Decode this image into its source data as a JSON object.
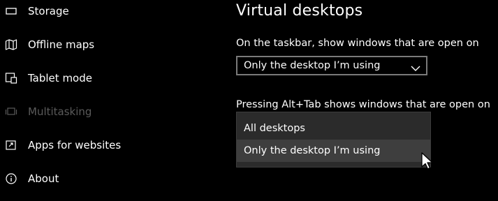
{
  "sidebar": {
    "items": [
      {
        "label": "Storage",
        "icon": "storage-icon"
      },
      {
        "label": "Offline maps",
        "icon": "map-icon"
      },
      {
        "label": "Tablet mode",
        "icon": "tablet-mode-icon"
      },
      {
        "label": "Multitasking",
        "icon": "multitasking-icon",
        "disabled": true
      },
      {
        "label": "Apps for websites",
        "icon": "apps-for-websites-icon"
      },
      {
        "label": "About",
        "icon": "info-icon"
      }
    ]
  },
  "main": {
    "title": "Virtual desktops",
    "taskbar": {
      "label": "On the taskbar, show windows that are open on",
      "selected": "Only the desktop I’m using"
    },
    "alttab": {
      "label": "Pressing Alt+Tab shows windows that are open on",
      "options": [
        "All desktops",
        "Only the desktop I’m using"
      ],
      "hovered": "Only the desktop I’m using"
    }
  },
  "colors": {
    "background": "#000000",
    "dropdown_bg": "#2b2b2b",
    "dropdown_hover": "#3e3e3e",
    "disabled_text": "#5a5a5a"
  }
}
